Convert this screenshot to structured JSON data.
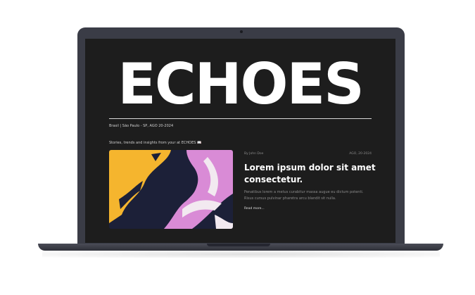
{
  "site": {
    "brand": "ECHOES",
    "meta_line": "Brasil | São Paulo - SP,  AGO 20-2024",
    "tagline": "Stories, trends and insights from your at ECHOES 📖"
  },
  "article": {
    "byline": "By John Doe",
    "date": "AGO, 20-2024",
    "headline": "Lorem ipsum dolor sit amet consectetur.",
    "excerpt": "Penatibus lorem a metus curabitur massa augue eu dictum potenti. Risus cursus pulvinar pharetra arcu blandit sit nulla.",
    "read_more": "Read more..."
  },
  "art": {
    "colors": {
      "yellow": "#f5b52e",
      "navy": "#1a1f3e",
      "pink": "#d98bd6",
      "white": "#f2e9f0"
    },
    "icon": "abstract-paint-art"
  }
}
